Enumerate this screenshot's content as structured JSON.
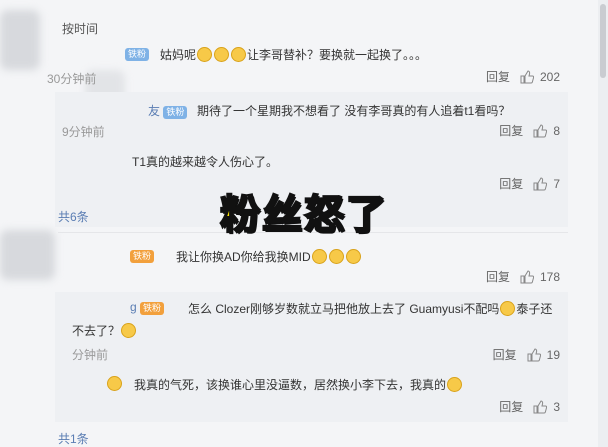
{
  "sort_label": "按时间",
  "overlay_text": "粉丝怒了",
  "reply_label": "回复",
  "comments": [
    {
      "badge": "铁粉",
      "text": "姑妈呢",
      "text2": "让李哥替补？要换就一起换了。。。",
      "time": "30分钟前",
      "likes": "202"
    },
    {
      "author": "友",
      "badge": "铁粉",
      "text": "期待了一个星期我不想看了 没有李哥真的有人追着t1看吗？",
      "time": "9分钟前",
      "likes": "8"
    },
    {
      "text": "T1真的越来越令人伤心了。",
      "likes": "7"
    },
    {
      "badge": "铁粉",
      "text": "我让你换AD你给我换MID",
      "likes": "178"
    },
    {
      "author": "g",
      "badge": "铁粉",
      "text": "怎么 Clozer刚够岁数就立马把他放上去了 Guamyusi不配吗",
      "text2": "泰子还",
      "text3": "不去了？",
      "time": "分钟前",
      "likes": "19"
    },
    {
      "text": "我真的气死，该换谁心里没逼数，居然换小李下去，我真的",
      "likes": "3"
    }
  ],
  "collapse_1": "共6条",
  "collapse_2": "共1条"
}
